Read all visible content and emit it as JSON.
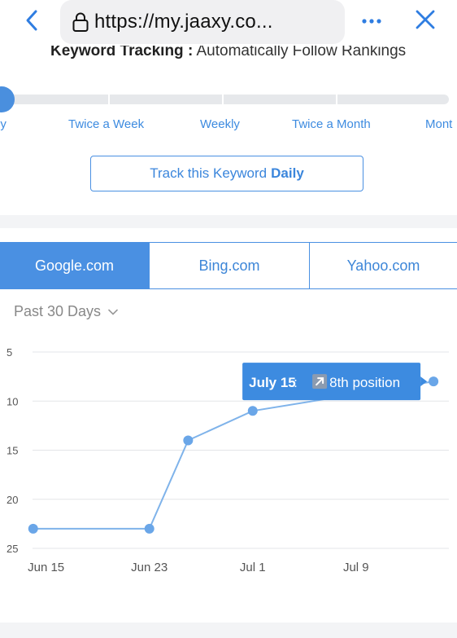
{
  "browser": {
    "url": "https://my.jaaxy.co...",
    "back_icon": "chevron-left-icon",
    "lock_icon": "lock-icon",
    "more_icon": "ellipsis-icon",
    "close_icon": "close-icon"
  },
  "tracking": {
    "heading_bold": "Keyword Tracking :",
    "heading_rest": " Automatically Follow Rankings",
    "frequency_options": [
      "ly",
      "Twice a Week",
      "Weekly",
      "Twice a Month",
      "Mont"
    ],
    "selected_index": 0,
    "button_prefix": "Track this Keyword",
    "button_frequency": "Daily"
  },
  "engines": {
    "tabs": [
      "Google.com",
      "Bing.com",
      "Yahoo.com"
    ],
    "active": "Google.com"
  },
  "range": {
    "label": "Past 30 Days",
    "icon": "chevron-down-icon"
  },
  "colors": {
    "accent": "#4a90e2",
    "line": "#7fb3ea",
    "point": "#6aa6e8",
    "tooltip_bg": "#3d8be0"
  },
  "chart_data": {
    "type": "line",
    "yaxis_reversed": true,
    "ylim": [
      5,
      25
    ],
    "yticks": [
      "5",
      "10",
      "15",
      "20",
      "25"
    ],
    "xticks": [
      "Jun 15",
      "Jun 23",
      "Jul 1",
      "Jul 9"
    ],
    "xlim": [
      "Jun 12",
      "Jul 16"
    ],
    "series": [
      {
        "points": [
          {
            "x": "Jun 14",
            "y": 23
          },
          {
            "x": "Jun 23",
            "y": 23
          },
          {
            "x": "Jun 26",
            "y": 14
          },
          {
            "x": "Jul 1",
            "y": 11
          },
          {
            "x": "Jul 15",
            "y": 8
          }
        ]
      }
    ],
    "tooltip": {
      "date": "July 15",
      "separator": " : ",
      "icon": "arrow-up-right-icon",
      "text": "8th position"
    }
  }
}
